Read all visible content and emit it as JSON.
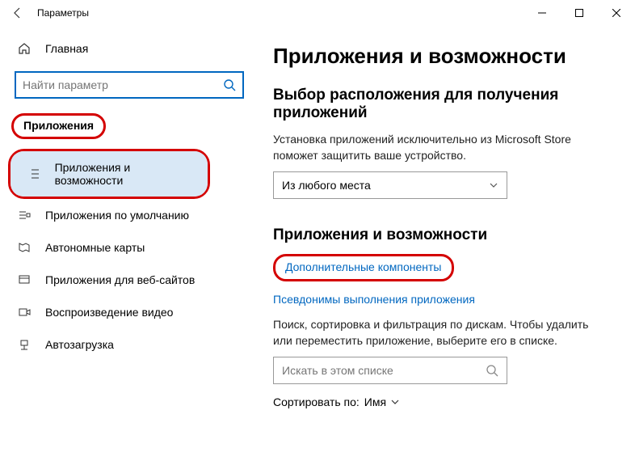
{
  "window": {
    "title": "Параметры"
  },
  "sidebar": {
    "home": "Главная",
    "search_placeholder": "Найти параметр",
    "section": "Приложения",
    "items": [
      {
        "label": "Приложения и возможности"
      },
      {
        "label": "Приложения по умолчанию"
      },
      {
        "label": "Автономные карты"
      },
      {
        "label": "Приложения для веб-сайтов"
      },
      {
        "label": "Воспроизведение видео"
      },
      {
        "label": "Автозагрузка"
      }
    ]
  },
  "content": {
    "title": "Приложения и возможности",
    "install_heading": "Выбор расположения для получения приложений",
    "install_desc": "Установка приложений исключительно из Microsoft Store поможет защитить ваше устройство.",
    "install_dropdown": "Из любого места",
    "apps_heading": "Приложения и возможности",
    "link_optional": "Дополнительные компоненты",
    "link_aliases": "Псевдонимы выполнения приложения",
    "apps_desc": "Поиск, сортировка и фильтрация по дискам. Чтобы удалить или переместить приложение, выберите его в списке.",
    "apps_search_placeholder": "Искать в этом списке",
    "sort_label": "Сортировать по:",
    "sort_value": "Имя"
  }
}
